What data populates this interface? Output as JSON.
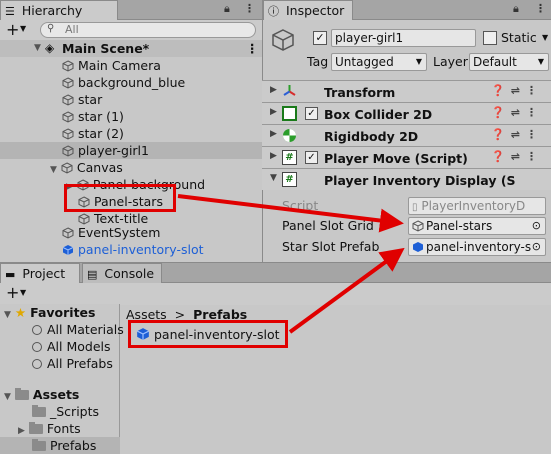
{
  "colors": {
    "arrow": "#e00000",
    "prefab_blue": "#1d5fd6",
    "panel_bg": "#c8c8c8",
    "tab_bg": "#a5a5a5"
  },
  "hierarchy": {
    "tab_label": "Hierarchy",
    "search_placeholder": "All",
    "add_label": "+",
    "scene_name": "Main Scene*",
    "items": [
      {
        "label": "Main Camera"
      },
      {
        "label": "background_blue"
      },
      {
        "label": "star"
      },
      {
        "label": "star (1)"
      },
      {
        "label": "star (2)"
      },
      {
        "label": "player-girl1"
      },
      {
        "label": "Canvas"
      },
      {
        "label": "Panel-background"
      },
      {
        "label": "Panel-stars"
      },
      {
        "label": "Text-title"
      },
      {
        "label": "EventSystem"
      },
      {
        "label": "panel-inventory-slot"
      }
    ]
  },
  "inspector": {
    "tab_label": "Inspector",
    "object_name": "player-girl1",
    "static_label": "Static",
    "tag_label": "Tag",
    "tag_value": "Untagged",
    "layer_label": "Layer",
    "layer_value": "Default",
    "components": [
      {
        "label": "Transform"
      },
      {
        "label": "Box Collider 2D"
      },
      {
        "label": "Rigidbody 2D"
      },
      {
        "label": "Player Move (Script)"
      },
      {
        "label": "Player Inventory Display (S"
      }
    ],
    "fields": {
      "script_label": "Script",
      "script_value": "PlayerInventoryD",
      "panel_slot_label": "Panel Slot Grid",
      "panel_slot_value": "Panel-stars",
      "star_slot_label": "Star Slot Prefab",
      "star_slot_value": "panel-inventory-s"
    }
  },
  "project": {
    "tab_label": "Project",
    "console_tab_label": "Console",
    "add_label": "+",
    "favorites_label": "Favorites",
    "favorites": [
      {
        "label": "All Materials"
      },
      {
        "label": "All Models"
      },
      {
        "label": "All Prefabs"
      }
    ],
    "assets_label": "Assets",
    "folders": [
      {
        "label": "_Scripts"
      },
      {
        "label": "Fonts"
      },
      {
        "label": "Prefabs"
      }
    ],
    "breadcrumb_root": "Assets",
    "breadcrumb_sep": ">",
    "breadcrumb_current": "Prefabs",
    "asset_item": "panel-inventory-slot"
  }
}
